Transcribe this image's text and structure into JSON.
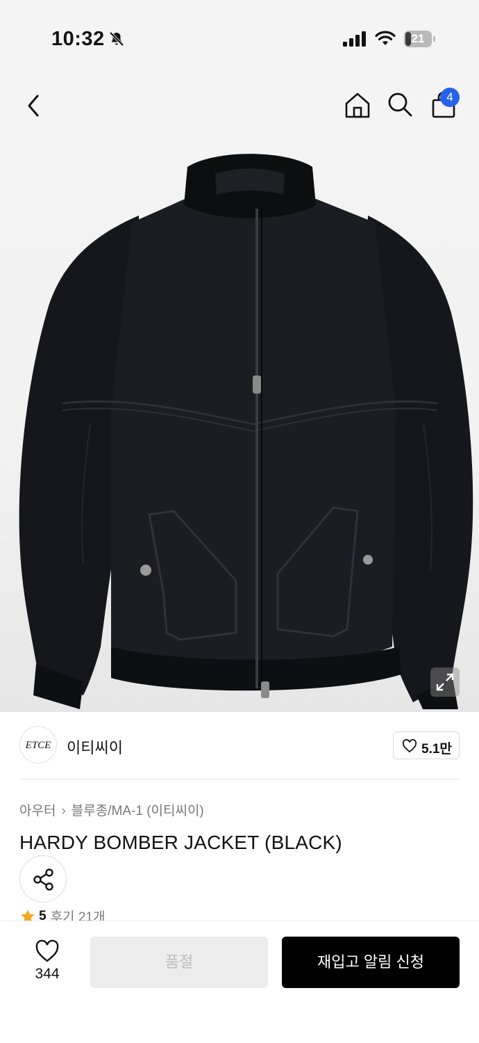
{
  "status_bar": {
    "time": "10:32",
    "battery": "21",
    "battery_level": 0.21
  },
  "header": {
    "cart_count": "4"
  },
  "brand": {
    "logo_text": "ETCE",
    "name": "이티씨이",
    "like_count": "5.1만"
  },
  "product": {
    "breadcrumb": [
      "아우터",
      "블루종/MA-1 (이티씨이)"
    ],
    "title": "HARDY BOMBER JACKET (BLACK)",
    "rating": "5",
    "reviews": "후기 21개"
  },
  "bottom_bar": {
    "wish_count": "344",
    "soldout_label": "품절",
    "restock_label": "재입고 알림 신청"
  },
  "colors": {
    "accent": "#2563eb",
    "star": "#f5a623",
    "primary_button": "#000000",
    "disabled_button": "#ececec"
  },
  "icons": [
    "back-icon",
    "home-icon",
    "search-icon",
    "bag-icon",
    "expand-icon",
    "heart-icon",
    "share-icon",
    "star-icon",
    "bell-off-icon",
    "signal-icon",
    "wifi-icon"
  ]
}
